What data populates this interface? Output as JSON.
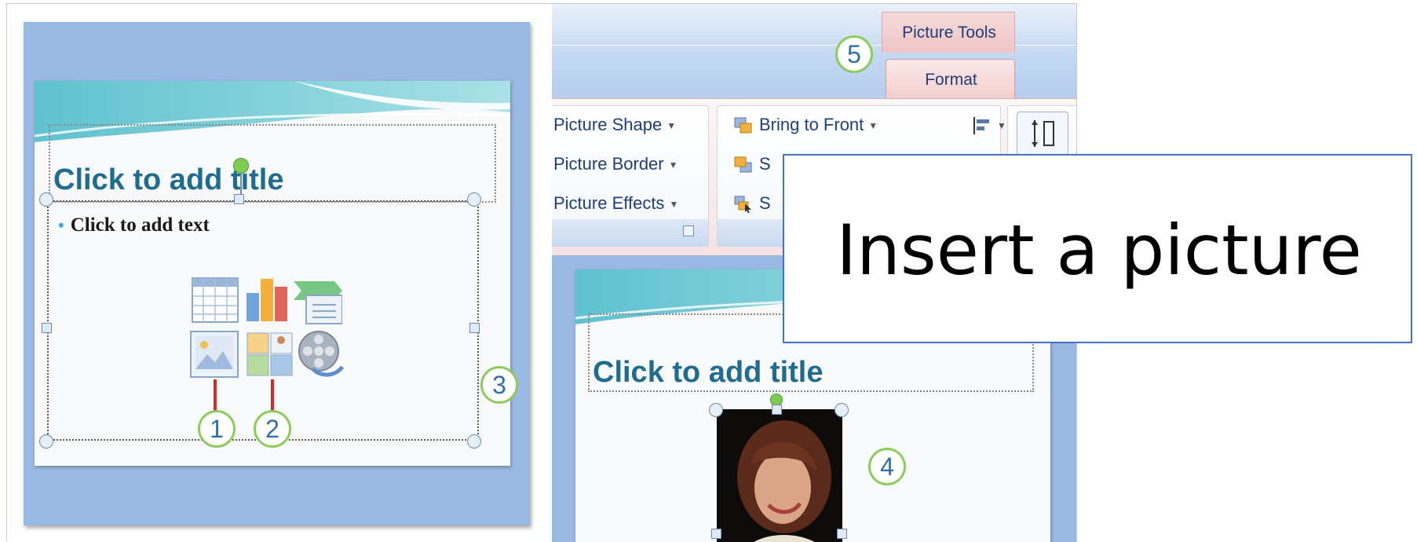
{
  "left_slide": {
    "title_placeholder": "Click to add title",
    "body_placeholder": "Click to add text",
    "content_icons": [
      "insert-table-icon",
      "insert-chart-icon",
      "insert-smartart-icon",
      "insert-picture-icon",
      "insert-clipart-icon",
      "insert-media-icon"
    ]
  },
  "callouts": {
    "c1": "1",
    "c2": "2",
    "c3": "3",
    "c4": "4",
    "c5": "5"
  },
  "ribbon": {
    "contextual_tab_group": "Picture Tools",
    "active_tab": "Format",
    "picture_styles": {
      "shape": "Picture Shape",
      "border": "Picture Border",
      "effects": "Picture Effects"
    },
    "arrange": {
      "bring_to_front": "Bring to Front",
      "send_partial": "S",
      "selection_partial": "S"
    }
  },
  "right_slide": {
    "title_placeholder": "Click to add title"
  },
  "overlay": {
    "heading": "Insert a picture"
  },
  "colors": {
    "slide_bg": "#9ab9e2",
    "title": "#1f6c8e",
    "callout_ring": "#8ccc5c",
    "overlay_border": "#4472c4",
    "format_tab": "#f3cdcd"
  }
}
